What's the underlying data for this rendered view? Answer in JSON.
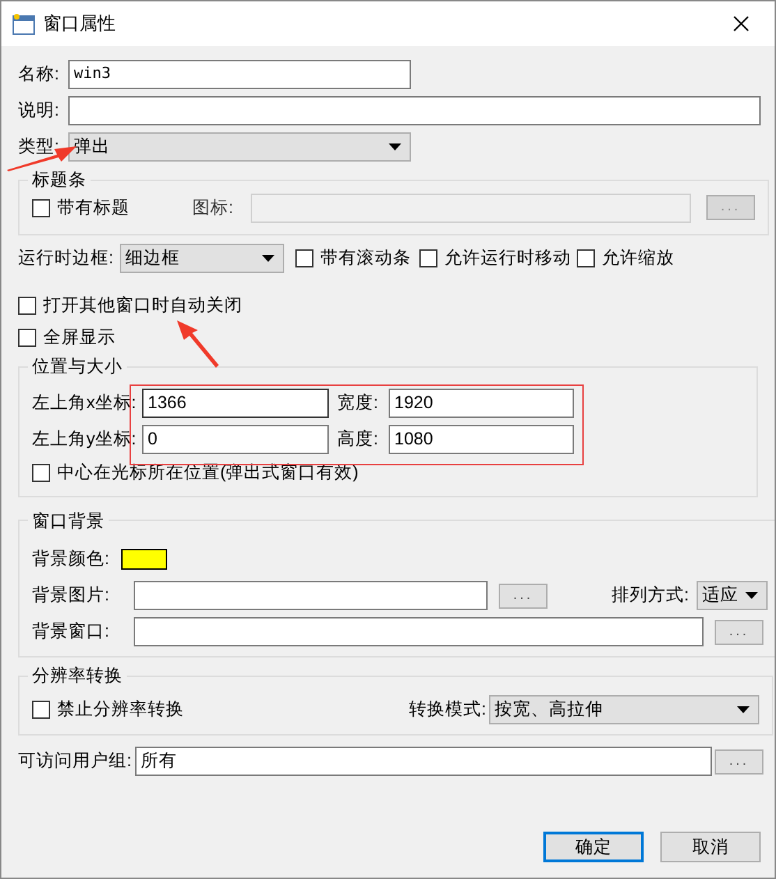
{
  "window": {
    "title": "窗口属性"
  },
  "name": {
    "label": "名称:",
    "value": "win3"
  },
  "description": {
    "label": "说明:"
  },
  "type": {
    "label": "类型:",
    "value": "弹出"
  },
  "title_bar_group": {
    "title": "标题条",
    "has_title": {
      "label": "带有标题",
      "checked": false
    },
    "icon": {
      "label": "图标:",
      "disabled": true
    },
    "browse": "..."
  },
  "runtime_border": {
    "label": "运行时边框:",
    "value": "细边框"
  },
  "runtime_options": [
    {
      "label": "带有滚动条",
      "checked": false
    },
    {
      "label": "允许运行时移动",
      "checked": false
    },
    {
      "label": "允许缩放",
      "checked": false
    }
  ],
  "window_options": [
    {
      "label": "打开其他窗口时自动关闭",
      "checked": false
    },
    {
      "label": "全屏显示",
      "checked": false
    }
  ],
  "position_group": {
    "title": "位置与大小",
    "fields": [
      {
        "label": "左上角x坐标:",
        "value": "1366",
        "focused": true
      },
      {
        "label": "宽度:",
        "value": "1920",
        "focused": false
      },
      {
        "label": "左上角y坐标:",
        "value": "0",
        "focused": false
      },
      {
        "label": "高度:",
        "value": "1080",
        "focused": false
      }
    ],
    "center_at_cursor": {
      "label": "中心在光标所在位置(弹出式窗口有效)",
      "checked": false
    }
  },
  "background_group": {
    "title": "窗口背景",
    "color_label": "背景颜色:",
    "color": "#ffff00",
    "image": {
      "label": "背景图片:",
      "browse": "..."
    },
    "arrange": {
      "label": "排列方式:",
      "value": "适应"
    },
    "window": {
      "label": "背景窗口:",
      "browse": "..."
    }
  },
  "resolution_group": {
    "title": "分辨率转换",
    "disable": {
      "label": "禁止分辨率转换",
      "checked": false
    },
    "mode": {
      "label": "转换模式:",
      "value": "按宽、高拉伸"
    }
  },
  "user_group": {
    "label": "可访问用户组:",
    "value": "所有",
    "browse": "..."
  },
  "buttons": [
    {
      "label": "确定",
      "default": true
    },
    {
      "label": "取消",
      "default": false
    }
  ]
}
